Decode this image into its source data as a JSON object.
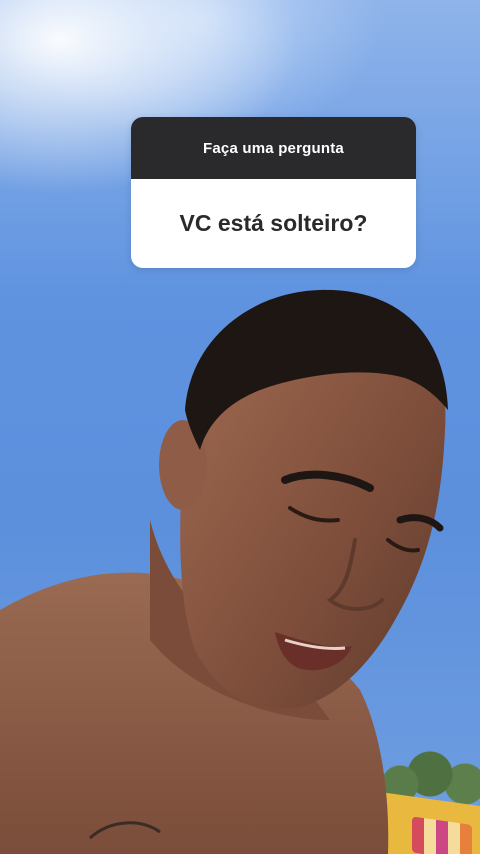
{
  "question_sticker": {
    "prompt": "Faça uma pergunta",
    "question": "VC está solteiro?"
  },
  "colors": {
    "sticker_header": "#2a2a2c",
    "sticker_body": "#ffffff",
    "sky": "#5f93e0",
    "skin": "#8a5a45",
    "hair": "#1e1612"
  },
  "photo_elements": [
    "sky",
    "person",
    "trees",
    "building"
  ]
}
